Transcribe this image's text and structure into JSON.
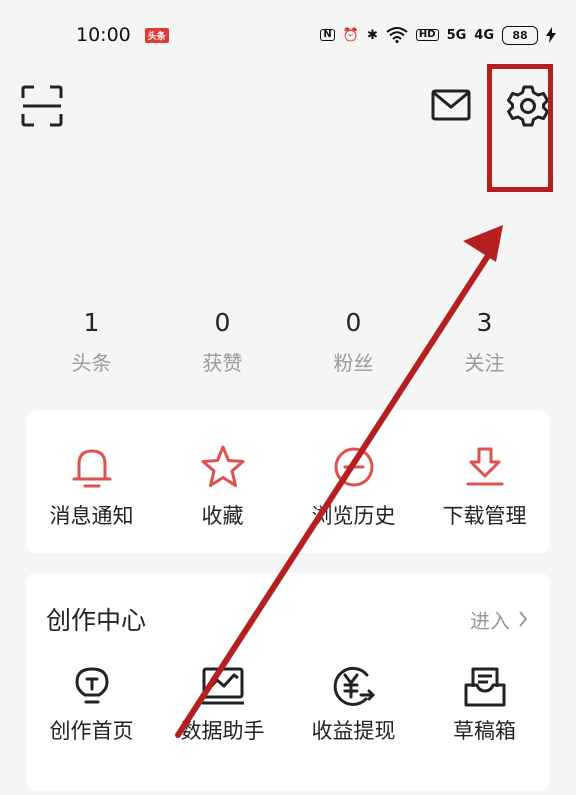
{
  "status_bar": {
    "time": "10:00",
    "app_badge": "头条",
    "network_icons": [
      "N",
      "⏰",
      "✱",
      "HD",
      "5G",
      "4G"
    ],
    "battery": "88"
  },
  "top_bar": {
    "icons": [
      "scan-icon",
      "mail-icon",
      "gear-icon"
    ]
  },
  "stats": [
    {
      "value": "1",
      "label": "头条"
    },
    {
      "value": "0",
      "label": "获赞"
    },
    {
      "value": "0",
      "label": "粉丝"
    },
    {
      "value": "3",
      "label": "关注"
    }
  ],
  "quick_actions": [
    {
      "label": "消息通知",
      "icon": "bell-icon"
    },
    {
      "label": "收藏",
      "icon": "star-icon"
    },
    {
      "label": "浏览历史",
      "icon": "history-icon"
    },
    {
      "label": "下载管理",
      "icon": "download-icon"
    }
  ],
  "creator_center": {
    "title": "创作中心",
    "enter_label": "进入",
    "items": [
      {
        "label": "创作首页",
        "icon": "lightbulb-icon"
      },
      {
        "label": "数据助手",
        "icon": "chart-icon"
      },
      {
        "label": "收益提现",
        "icon": "yuan-coin-icon"
      },
      {
        "label": "草稿箱",
        "icon": "drafts-box-icon"
      }
    ]
  },
  "colors": {
    "accent": "#e05050",
    "annotation": "#b51f1f",
    "background": "#f5f5f5"
  }
}
